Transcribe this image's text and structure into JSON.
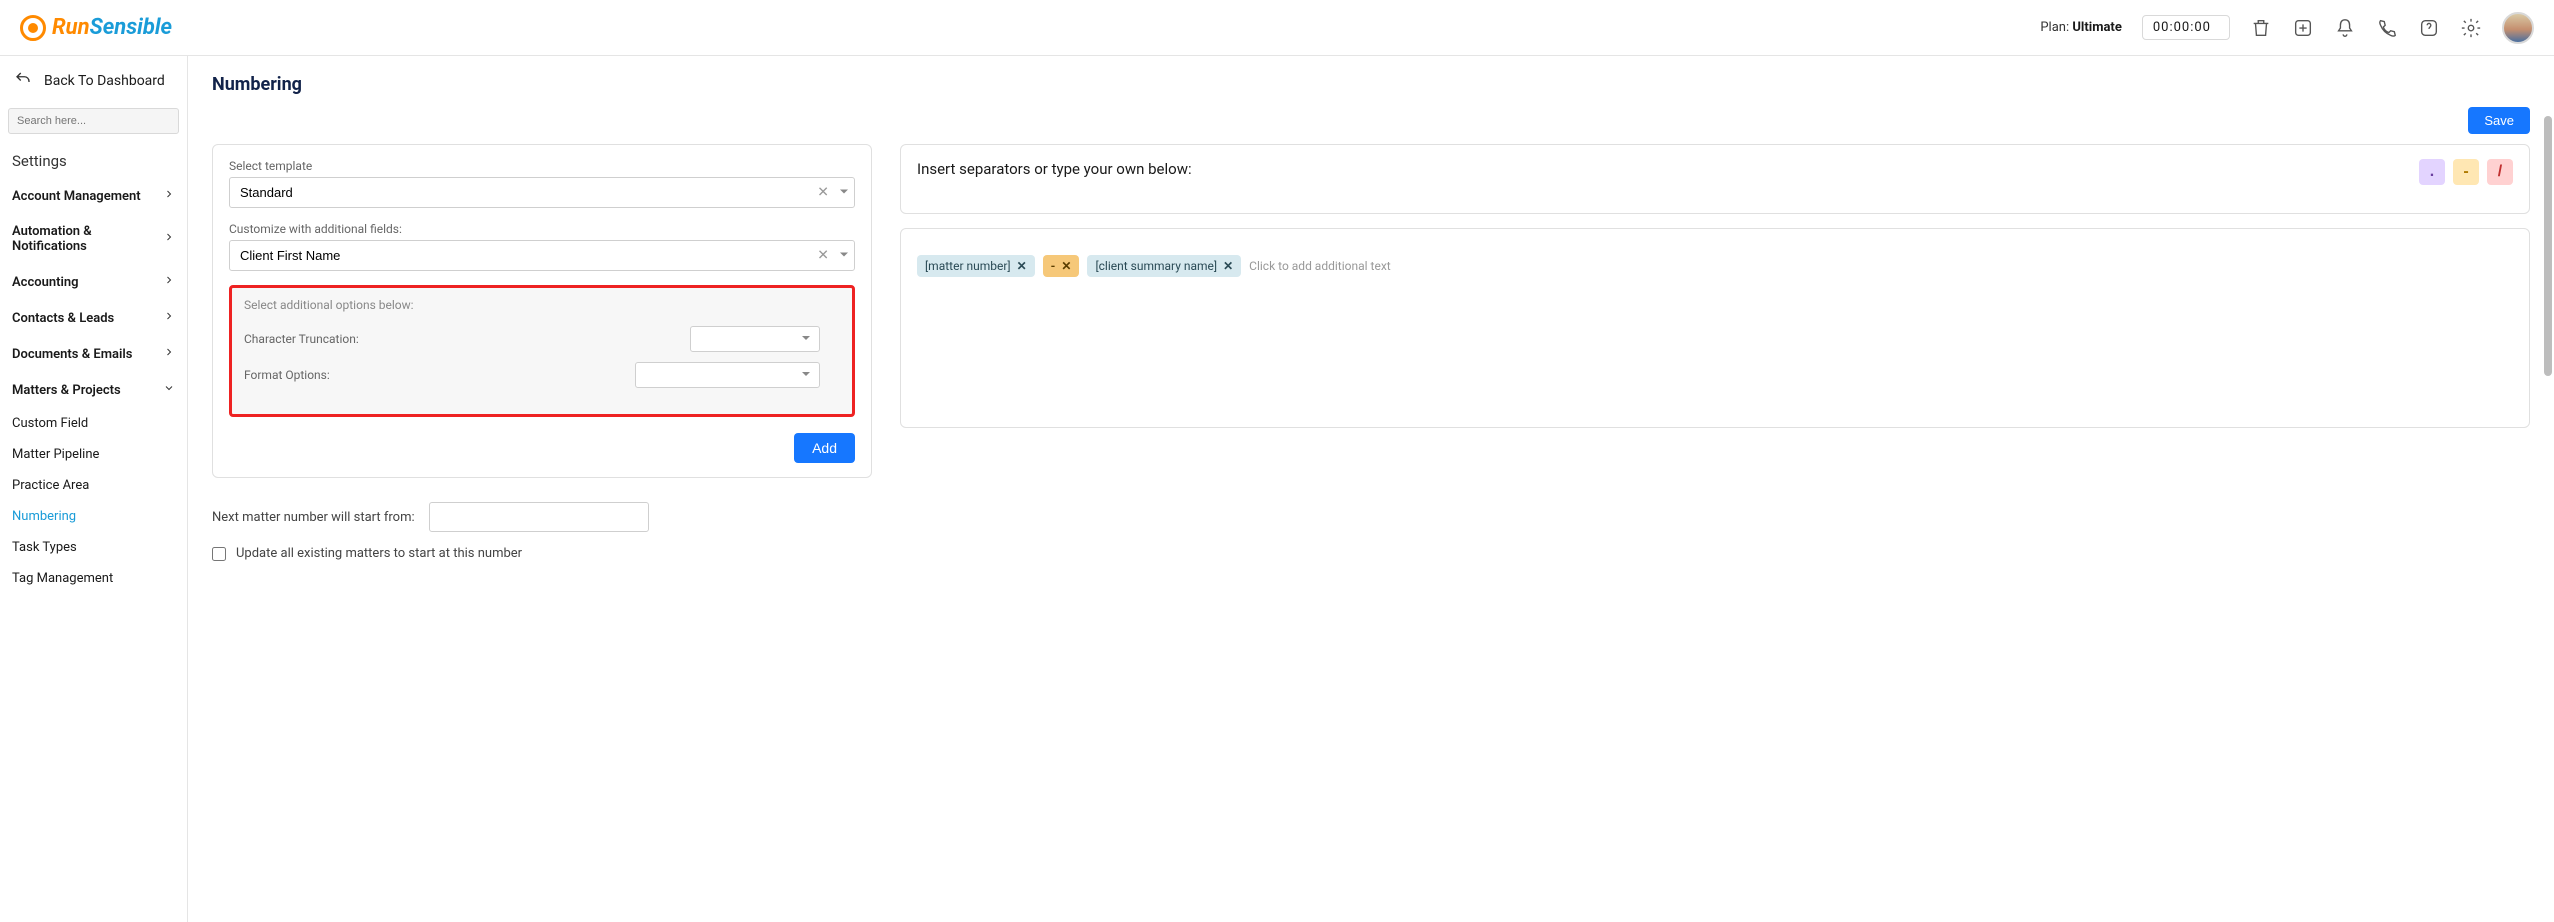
{
  "header": {
    "logo_run": "Run",
    "logo_sensible": "Sensible",
    "plan_label": "Plan:",
    "plan_value": "Ultimate",
    "timer": "00:00:00"
  },
  "sidebar": {
    "back_label": "Back To Dashboard",
    "search_placeholder": "Search here...",
    "settings_header": "Settings",
    "groups": [
      {
        "label": "Account Management",
        "expanded": false
      },
      {
        "label": "Automation & Notifications",
        "expanded": false
      },
      {
        "label": "Accounting",
        "expanded": false
      },
      {
        "label": "Contacts & Leads",
        "expanded": false
      },
      {
        "label": "Documents & Emails",
        "expanded": false
      },
      {
        "label": "Matters & Projects",
        "expanded": true
      }
    ],
    "sub_matters": [
      {
        "label": "Custom Field",
        "active": false
      },
      {
        "label": "Matter Pipeline",
        "active": false
      },
      {
        "label": "Practice Area",
        "active": false
      },
      {
        "label": "Numbering",
        "active": true
      },
      {
        "label": "Task Types",
        "active": false
      },
      {
        "label": "Tag Management",
        "active": false
      }
    ]
  },
  "page": {
    "title": "Numbering",
    "save_label": "Save",
    "template_label": "Select template",
    "template_value": "Standard",
    "customize_label": "Customize with additional fields:",
    "customize_value": "Client First Name",
    "options_title": "Select additional options below:",
    "char_trunc_label": "Character Truncation:",
    "format_opts_label": "Format Options:",
    "add_label": "Add",
    "next_num_label": "Next matter number will start from:",
    "update_all_label": "Update all existing matters to start at this number",
    "insert_sep_title": "Insert separators or type your own below:",
    "sep_dot": ".",
    "sep_dash": "-",
    "sep_slash": "/",
    "tags": {
      "matter": "[matter number]",
      "sep": "-",
      "summary": "[client summary name]",
      "hint": "Click to add additional text"
    }
  }
}
